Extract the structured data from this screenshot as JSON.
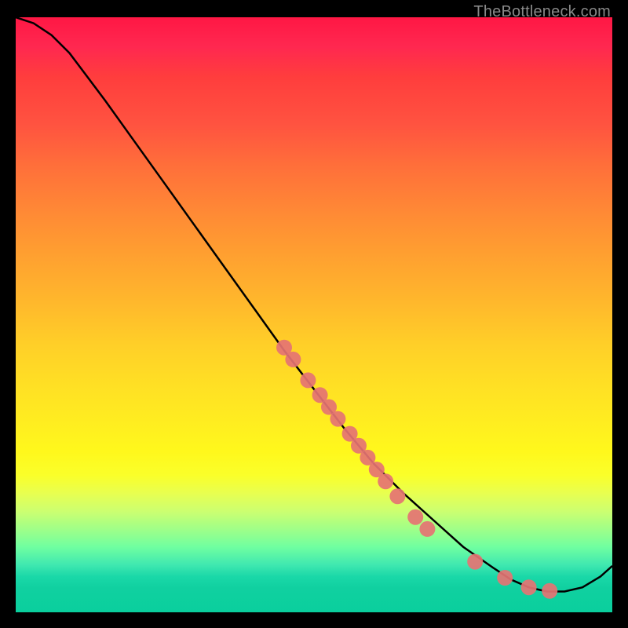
{
  "watermark": "TheBottleneck.com",
  "chart_data": {
    "type": "line",
    "title": "",
    "xlabel": "",
    "ylabel": "",
    "xlim": [
      0,
      100
    ],
    "ylim": [
      0,
      100
    ],
    "grid": false,
    "series": [
      {
        "name": "curve",
        "color": "#000000",
        "x": [
          0,
          3,
          6,
          9,
          12,
          15,
          20,
          25,
          30,
          35,
          40,
          45,
          50,
          55,
          60,
          65,
          70,
          75,
          80,
          83,
          86,
          89,
          92,
          95,
          98,
          100
        ],
        "y": [
          100,
          99,
          97,
          94,
          90,
          86,
          79,
          72,
          65,
          58,
          51,
          44,
          37.5,
          31,
          25,
          20,
          15.5,
          11,
          7.5,
          5.5,
          4.2,
          3.5,
          3.5,
          4.2,
          6.0,
          7.8
        ]
      }
    ],
    "scatter": {
      "name": "markers",
      "color": "#e57373",
      "radius": 10,
      "points": [
        {
          "x": 45,
          "y": 44.5
        },
        {
          "x": 46.5,
          "y": 42.5
        },
        {
          "x": 49,
          "y": 39
        },
        {
          "x": 51,
          "y": 36.5
        },
        {
          "x": 52.5,
          "y": 34.5
        },
        {
          "x": 54,
          "y": 32.5
        },
        {
          "x": 56,
          "y": 30
        },
        {
          "x": 57.5,
          "y": 28
        },
        {
          "x": 59,
          "y": 26
        },
        {
          "x": 60.5,
          "y": 24
        },
        {
          "x": 62,
          "y": 22
        },
        {
          "x": 64,
          "y": 19.5
        },
        {
          "x": 67,
          "y": 16
        },
        {
          "x": 69,
          "y": 14
        },
        {
          "x": 77,
          "y": 8.5
        },
        {
          "x": 82,
          "y": 5.8
        },
        {
          "x": 86,
          "y": 4.2
        },
        {
          "x": 89.5,
          "y": 3.6
        }
      ]
    }
  }
}
